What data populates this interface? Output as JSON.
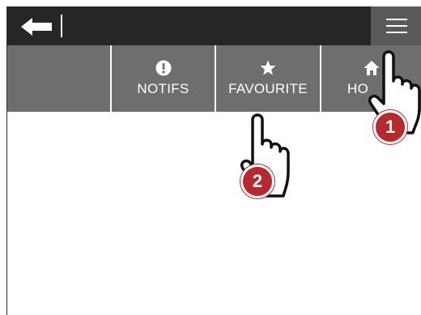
{
  "header": {
    "back_icon": "arrow-left-icon",
    "menu_icon": "hamburger-menu-icon",
    "background": "#262626",
    "menu_background": "#5a5a5a"
  },
  "tabs": [
    {
      "label": "",
      "icon": ""
    },
    {
      "label": "NOTIFS",
      "icon": "exclamation-icon"
    },
    {
      "label": "FAVOURITE",
      "icon": "star-icon"
    },
    {
      "label": "HO",
      "icon": "home-icon"
    }
  ],
  "tab_background": "#6e6e6e",
  "steps": [
    {
      "number": "1",
      "color": "#b52a2f"
    },
    {
      "number": "2",
      "color": "#b52a2f"
    }
  ]
}
